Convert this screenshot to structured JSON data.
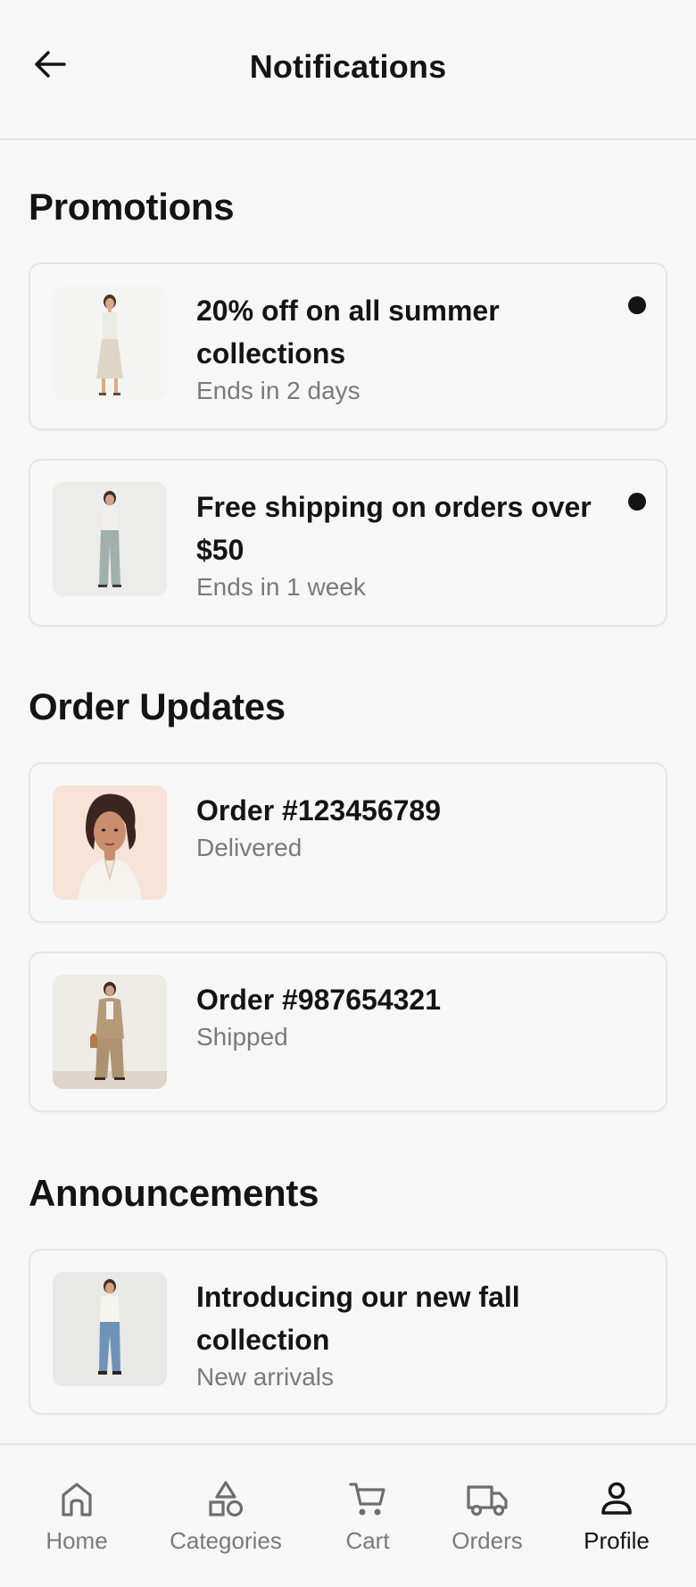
{
  "header": {
    "title": "Notifications",
    "back_icon": "arrow-left-icon"
  },
  "sections": [
    {
      "title": "Promotions",
      "items": [
        {
          "title": "20% off on all summer collections",
          "subtitle": "Ends in 2 days",
          "unread": true,
          "image": "woman-summer-dress"
        },
        {
          "title": "Free shipping on orders over $50",
          "subtitle": "Ends in 1 week",
          "unread": true,
          "image": "woman-wide-trousers"
        }
      ]
    },
    {
      "title": "Order Updates",
      "items": [
        {
          "title": "Order #123456789",
          "subtitle": "Delivered",
          "unread": false,
          "image": "illustrated-woman-portrait"
        },
        {
          "title": "Order #987654321",
          "subtitle": "Shipped",
          "unread": false,
          "image": "woman-beige-suit"
        }
      ]
    },
    {
      "title": "Announcements",
      "items": [
        {
          "title": "Introducing our new fall collection",
          "subtitle": "New arrivals",
          "unread": false,
          "image": "woman-jeans-white-top"
        }
      ]
    }
  ],
  "tabbar": {
    "items": [
      {
        "label": "Home",
        "icon": "home-icon",
        "active": false
      },
      {
        "label": "Categories",
        "icon": "shapes-icon",
        "active": false
      },
      {
        "label": "Cart",
        "icon": "cart-icon",
        "active": false
      },
      {
        "label": "Orders",
        "icon": "truck-icon",
        "active": false
      },
      {
        "label": "Profile",
        "icon": "user-icon",
        "active": true
      }
    ]
  },
  "colors": {
    "background": "#f7f7f7",
    "text": "#141414",
    "muted": "#7a7a7a",
    "border": "#e6e6e6",
    "unread_dot": "#141414"
  }
}
